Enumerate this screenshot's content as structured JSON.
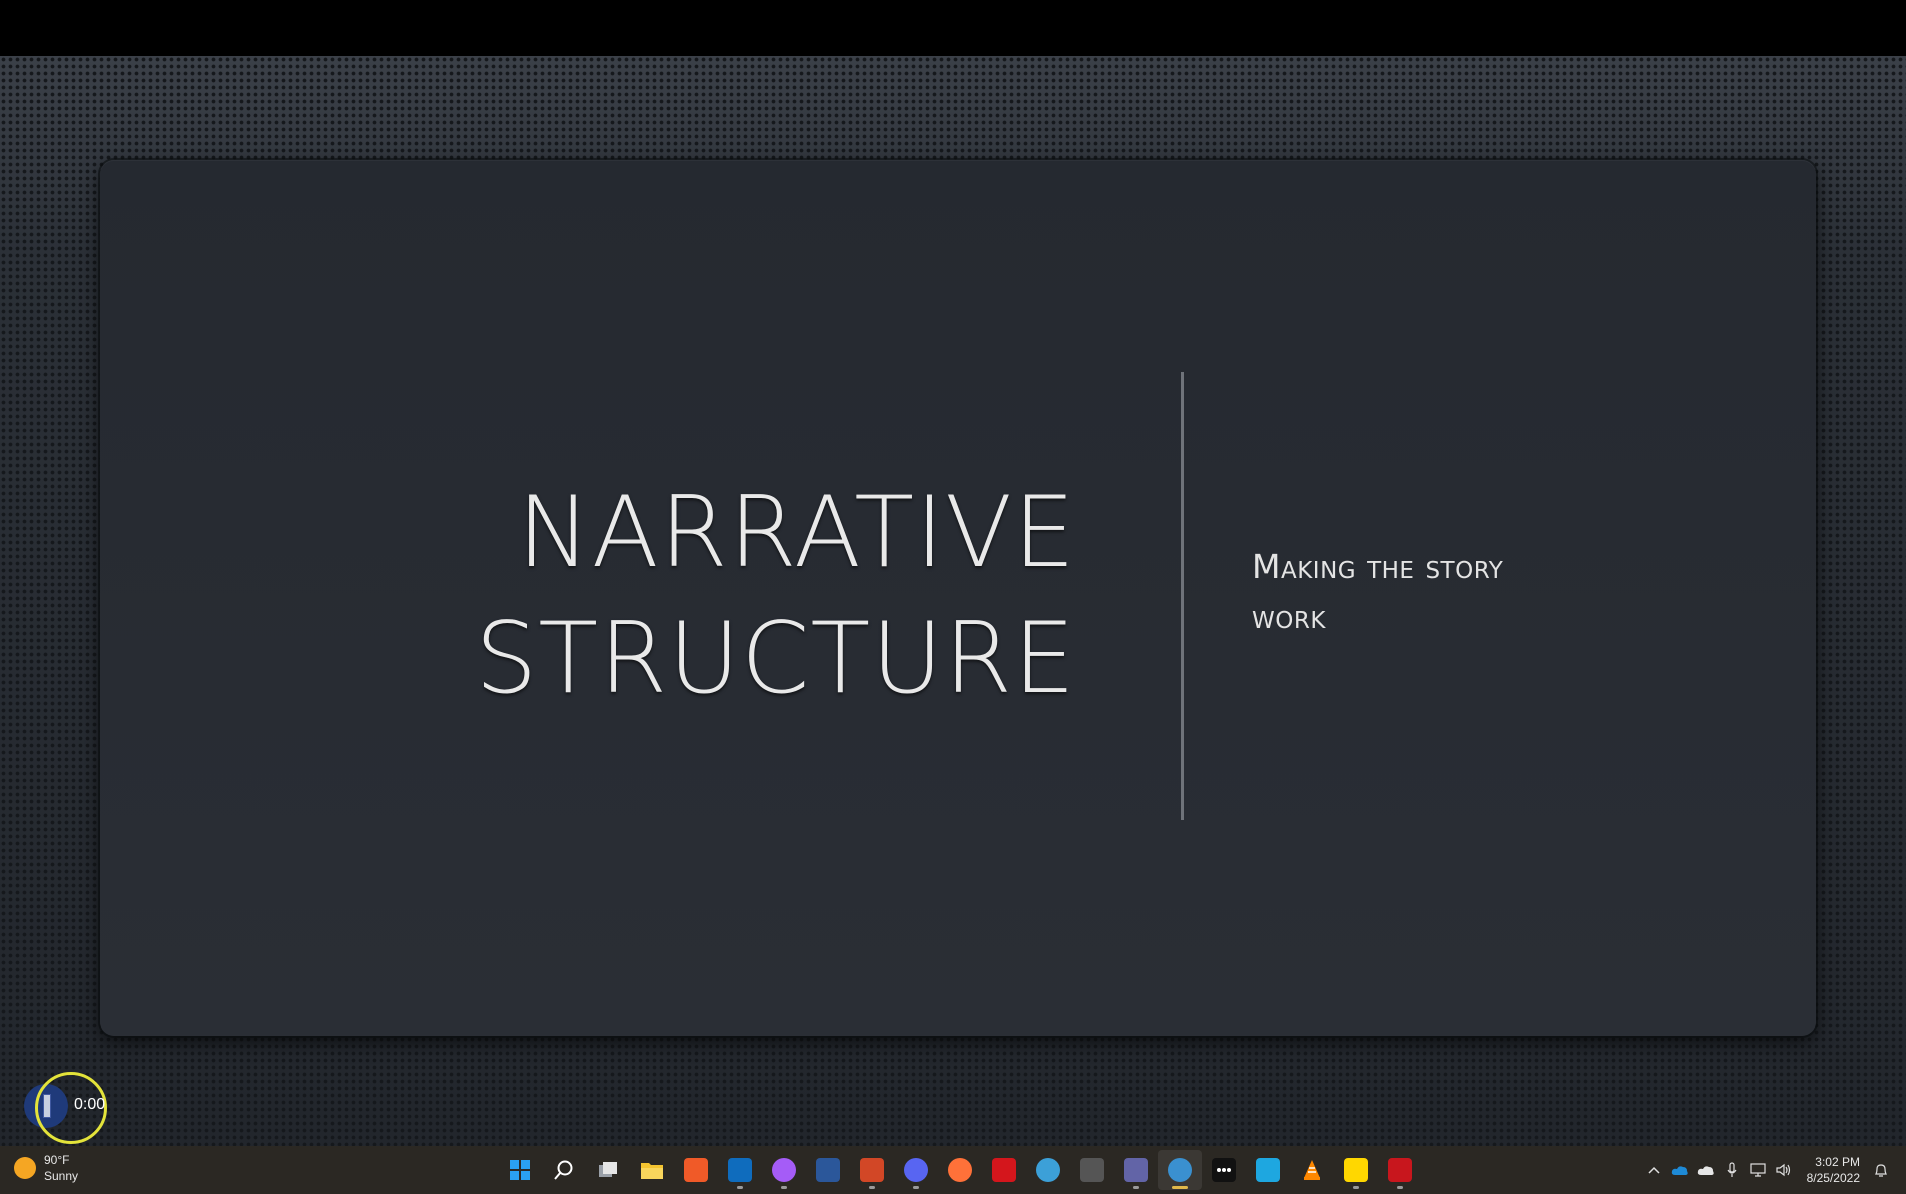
{
  "slide": {
    "title_line1": "NARRATIVE",
    "title_line2": "STRUCTURE",
    "subtitle_line1": "Making the story",
    "subtitle_line2": "work"
  },
  "recorder": {
    "time": "0:00"
  },
  "weather": {
    "temperature": "90°F",
    "condition": "Sunny"
  },
  "taskbar": {
    "apps": [
      {
        "name": "start-icon",
        "color": "#2aa0f0"
      },
      {
        "name": "search-icon",
        "color": "#ffffff"
      },
      {
        "name": "task-view-icon",
        "color": "#d0d0d0"
      },
      {
        "name": "file-explorer-icon",
        "color": "#f4c430"
      },
      {
        "name": "brave-browser-icon",
        "color": "#f05a28"
      },
      {
        "name": "outlook-icon",
        "color": "#0f6cbd"
      },
      {
        "name": "messenger-icon",
        "color": "#a55cf7"
      },
      {
        "name": "word-icon",
        "color": "#2b579a"
      },
      {
        "name": "powerpoint-icon",
        "color": "#d24726"
      },
      {
        "name": "discord-icon",
        "color": "#5865f2"
      },
      {
        "name": "firefox-icon",
        "color": "#ff7139"
      },
      {
        "name": "acrobat-icon",
        "color": "#d4161c"
      },
      {
        "name": "globe-icon",
        "color": "#3ca0d8"
      },
      {
        "name": "media-app-icon",
        "color": "#555555"
      },
      {
        "name": "teams-icon",
        "color": "#6264a7"
      },
      {
        "name": "screen-recorder-icon",
        "color": "#3a90d0"
      },
      {
        "name": "dots-app-icon",
        "color": "#111111"
      },
      {
        "name": "ccleaner-icon",
        "color": "#1ea7e0"
      },
      {
        "name": "vlc-icon",
        "color": "#ff8800"
      },
      {
        "name": "sticky-notes-icon",
        "color": "#ffd700"
      },
      {
        "name": "pdf-app-icon",
        "color": "#c8161d"
      }
    ]
  },
  "clock": {
    "time": "3:02 PM",
    "date": "8/25/2022"
  }
}
